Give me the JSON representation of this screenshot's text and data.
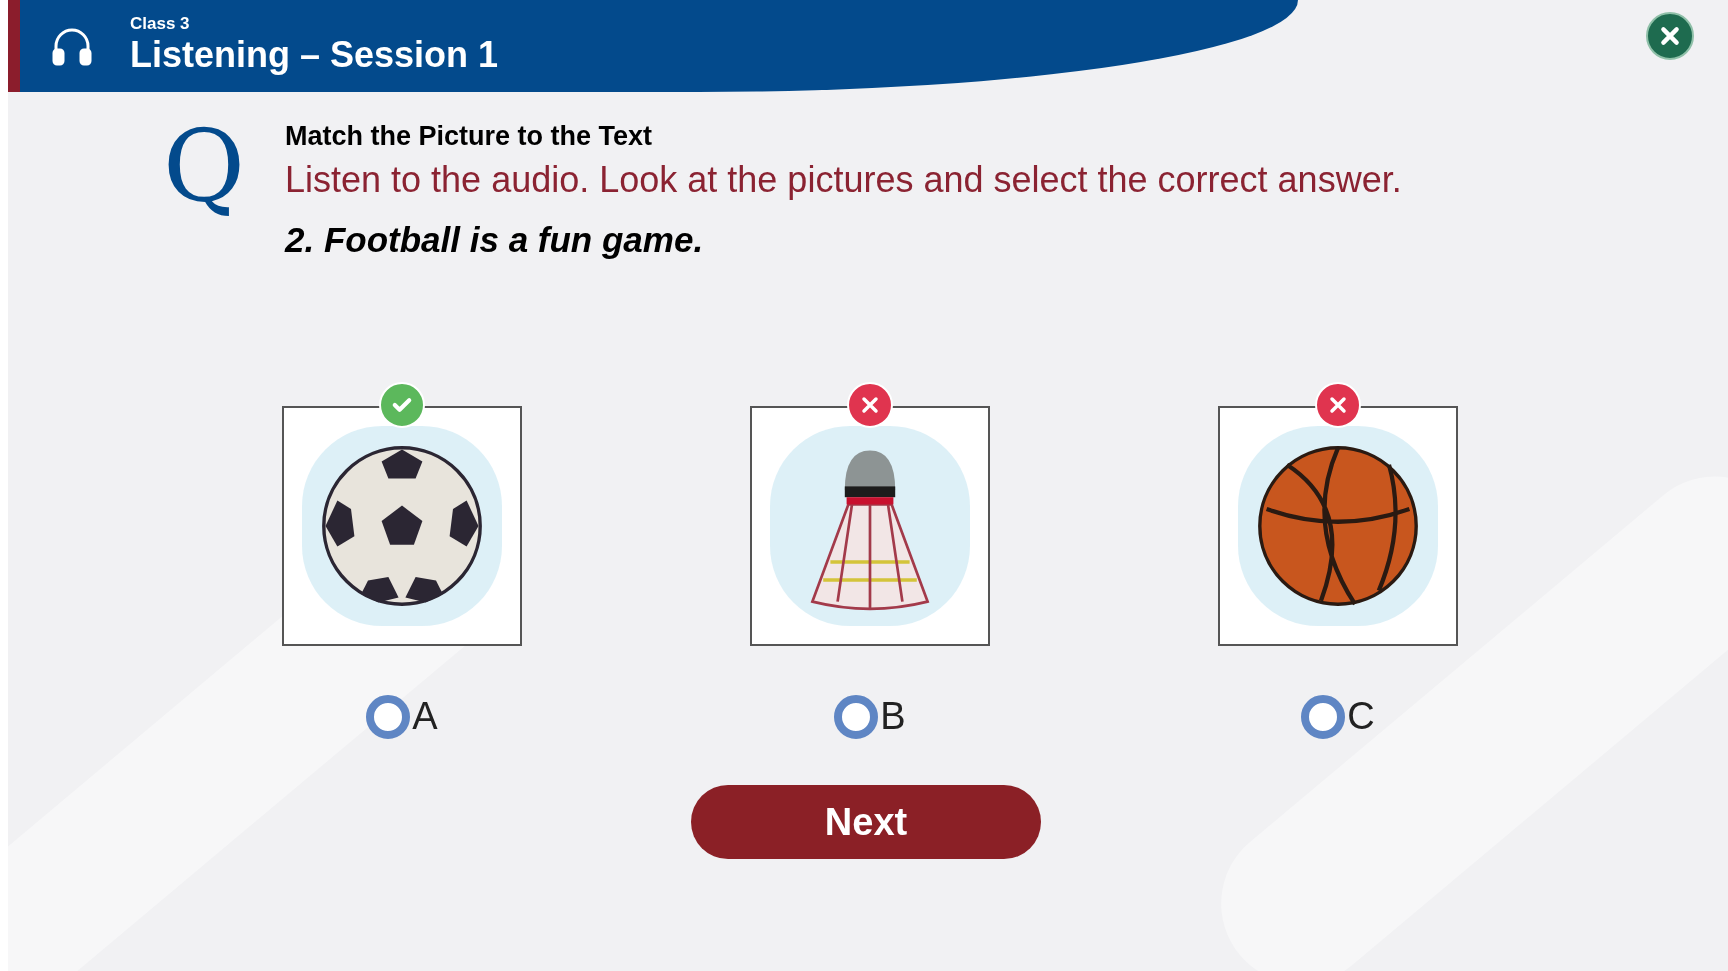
{
  "header": {
    "class_label": "Class 3",
    "title": "Listening – Session 1"
  },
  "question": {
    "letter": "Q",
    "heading": "Match the Picture to the Text",
    "instruction": "Listen to the audio. Look at the pictures and select the correct answer.",
    "prompt": "2. Football is a fun game."
  },
  "options": [
    {
      "label": "A",
      "kind": "soccer-ball",
      "correct": true,
      "selected": false
    },
    {
      "label": "B",
      "kind": "shuttlecock",
      "correct": false,
      "selected": false
    },
    {
      "label": "C",
      "kind": "basketball",
      "correct": false,
      "selected": false
    }
  ],
  "next_button": "Next"
}
